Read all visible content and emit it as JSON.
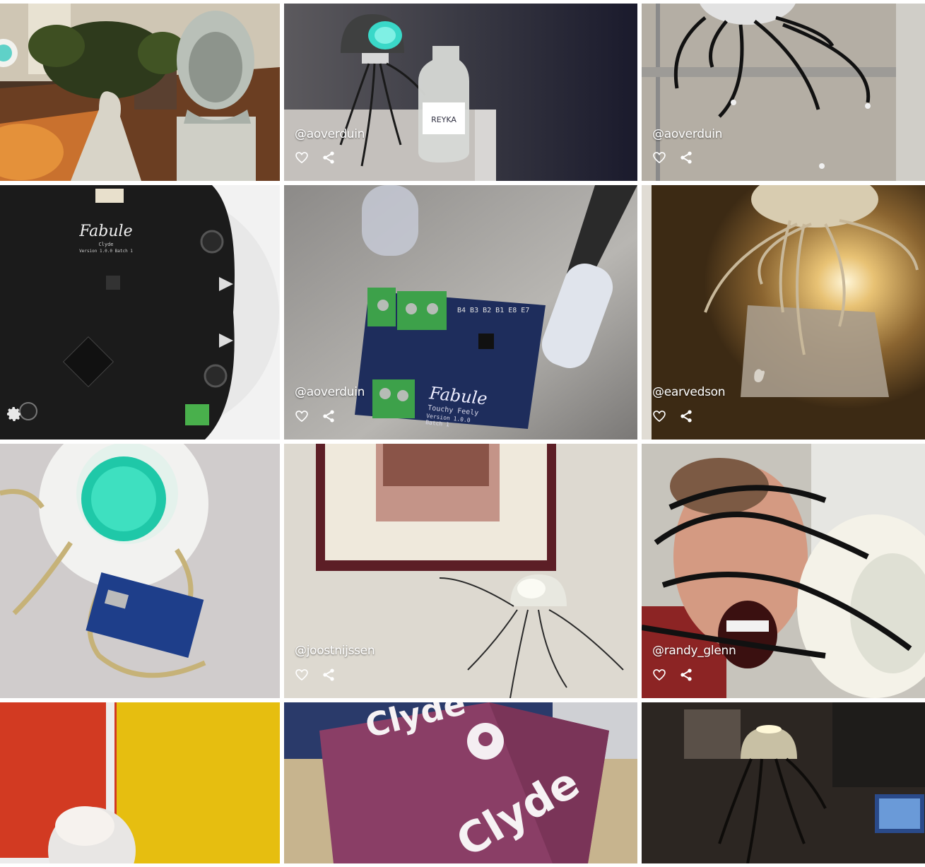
{
  "gallery": {
    "tiles": [
      {
        "handle": ""
      },
      {
        "handle": "@aoverduin"
      },
      {
        "handle": "@aoverduin"
      },
      {
        "handle": ""
      },
      {
        "handle": "@aoverduin"
      },
      {
        "handle": "@earvedson"
      },
      {
        "handle": ""
      },
      {
        "handle": "@joostnijssen"
      },
      {
        "handle": "@randy_glenn"
      },
      {
        "handle": ""
      },
      {
        "handle": ""
      },
      {
        "handle": ""
      }
    ],
    "pcb": {
      "brand": "Fabule",
      "subtitle": "Clyde",
      "version": "Version 1.0.0 Batch 1"
    },
    "board": {
      "brand": "Fabule",
      "line1": "Touchy Feely",
      "line2": "Version 1.0.0",
      "line3": "Batch 1",
      "pins": "B4 B3 B2 B1 E8 E7"
    },
    "bottle": {
      "label": "REYKA"
    },
    "box": {
      "text1": "Clyde",
      "text2": "Clyde"
    }
  },
  "icons": {
    "like": "heart-icon",
    "share": "share-icon",
    "settings": "gear-icon"
  },
  "colors": {
    "overlay_text": "#ffffff",
    "background": "#ffffff"
  }
}
